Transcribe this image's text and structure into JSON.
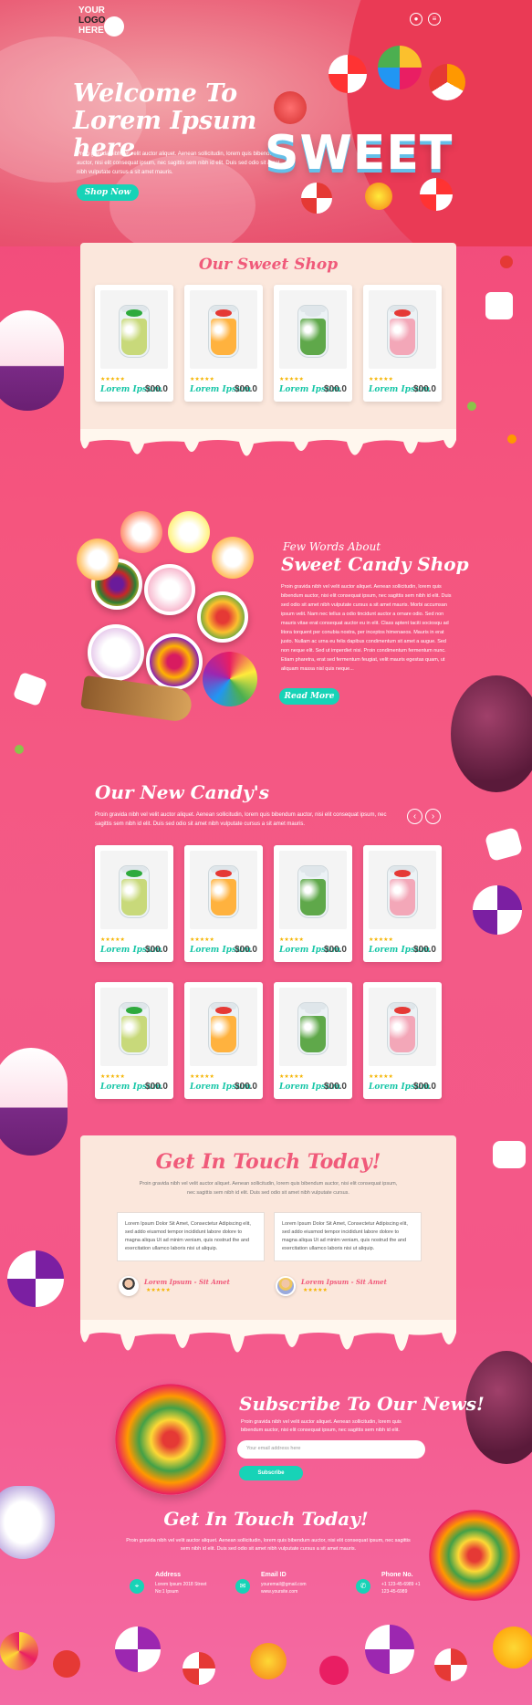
{
  "header": {
    "logo_line1": "YOUR",
    "logo_line2": "LOGO",
    "logo_line3": "HERE",
    "icons": [
      "user-icon",
      "menu-icon"
    ]
  },
  "hero": {
    "title": "Welcome To Lorem Ipsum here",
    "text": "Proin gravida nibh vel velit auctor aliquet. Aenean sollicitudin, lorem quis bibendum auctor, nisi elit consequat ipsum, nec sagittis sem nibh id elit. Duis sed odio sit amet nibh vulputate cursus a sit amet mauris.",
    "button": "Shop Now",
    "sweet": "SWEET"
  },
  "shop": {
    "title": "Our Sweet Shop",
    "products": [
      {
        "name": "Lorem Ipsum",
        "price": "$00.0",
        "rating": 5
      },
      {
        "name": "Lorem Ipsum",
        "price": "$00.0",
        "rating": 5
      },
      {
        "name": "Lorem Ipsum",
        "price": "$00.0",
        "rating": 5
      },
      {
        "name": "Lorem Ipsum",
        "price": "$00.0",
        "rating": 5
      }
    ]
  },
  "about": {
    "subtitle": "Few Words About",
    "title": "Sweet Candy Shop",
    "text": "Proin gravida nibh vel velit auctor aliquet. Aenean sollicitudin, lorem quis bibendum auctor, nisi elit consequat ipsum, nec sagittis sem nibh id elit. Duis sed odio sit amet nibh vulputate cursus a sit amet mauris. Morbi accumsan ipsum velit. Nam nec tellus a odio tincidunt auctor a ornare odio. Sed non mauris vitae erat consequat auctor eu in elit. Class aptent taciti sociosqu ad litora torquent per conubia nostra, per inceptos himenaeos. Mauris in erat justo. Nullam ac urna eu felis dapibus condimentum sit amet a augue. Sed non neque elit. Sed ut imperdiet nisi. Proin condimentum fermentum nunc. Etiam pharetra, erat sed fermentum feugiat, velit mauris egestas quam, ut aliquam massa nisl quis neque...",
    "button": "Read More"
  },
  "new_candy": {
    "title": "Our New Candy's",
    "text": "Proin gravida nibh vel velit auctor aliquet. Aenean sollicitudin, lorem quis bibendum auctor, nisi elit consequat ipsum, nec sagittis sem nibh id elit. Duis sed odio sit amet nibh vulputate cursus a sit amet mauris.",
    "prev": "‹",
    "next": "›",
    "products": [
      {
        "name": "Lorem Ipsum",
        "price": "$00.0"
      },
      {
        "name": "Lorem Ipsum",
        "price": "$00.0"
      },
      {
        "name": "Lorem Ipsum",
        "price": "$00.0"
      },
      {
        "name": "Lorem Ipsum",
        "price": "$00.0"
      },
      {
        "name": "Lorem Ipsum",
        "price": "$00.0"
      },
      {
        "name": "Lorem Ipsum",
        "price": "$00.0"
      },
      {
        "name": "Lorem Ipsum",
        "price": "$00.0"
      },
      {
        "name": "Lorem Ipsum",
        "price": "$00.0"
      }
    ]
  },
  "testimonials": {
    "title": "Get In Touch Today!",
    "text": "Proin gravida nibh vel velit auctor aliquet. Aenean sollicitudin, lorem quis bibendum auctor, nisi elit consequat ipsum, nec sagittis sem nibh id elit. Duis sed odio sit amet nibh vulputate cursus.",
    "items": [
      {
        "quote": "Lorem Ipsum Dolor Sit Amet, Consectetur Adipiscing elit, sed addo eiusmod tempor incididunt labore dolore to magna aliqua Ut ad minim veniam, quis nostrud the and exercitation ullamco laboris nisi ut aliquip.",
        "name": "Lorem Ipsum - Sit Amet",
        "rating": 5
      },
      {
        "quote": "Lorem Ipsum Dolor Sit Amet, Consectetur Adipiscing elit, sed addo eiusmod tempor incididunt labore dolore to magna aliqua Ut ad minim veniam, quis nostrud the and exercitation ullamco laboris nisi ut aliquip.",
        "name": "Lorem Ipsum - Sit Amet",
        "rating": 5
      }
    ]
  },
  "subscribe": {
    "title": "Subscribe To Our News!",
    "text": "Proin gravida nibh vel velit auctor aliquet. Aenean sollicitudin, lorem quis bibendum auctor, nisi elit consequat ipsum, nec sagittis sem nibh id elit.",
    "placeholder": "Your email address here",
    "button": "Subscribe"
  },
  "contact": {
    "title": "Get In Touch Today!",
    "text": "Proin gravida nibh vel velit auctor aliquet. Aenean sollicitudin, lorem quis bibendum auctor, nisi elit consequat ipsum, nec sagittis sem nibh id elit. Duis sed odio sit amet nibh vulputate cursus a sit amet mauris.",
    "address_label": "Address",
    "address_value": "Lorem Ipsum 2018 Street No:1 Ipsum",
    "email_label": "Email ID",
    "email_value": "youremail@gmail.com www.yoursite.com",
    "phone_label": "Phone No.",
    "phone_value": "+1 123-45-6989 +1 123-45-6989"
  },
  "colors": {
    "accent": "#17d3b7",
    "brand": "#f05a7a",
    "panel": "#fbe7dc"
  }
}
